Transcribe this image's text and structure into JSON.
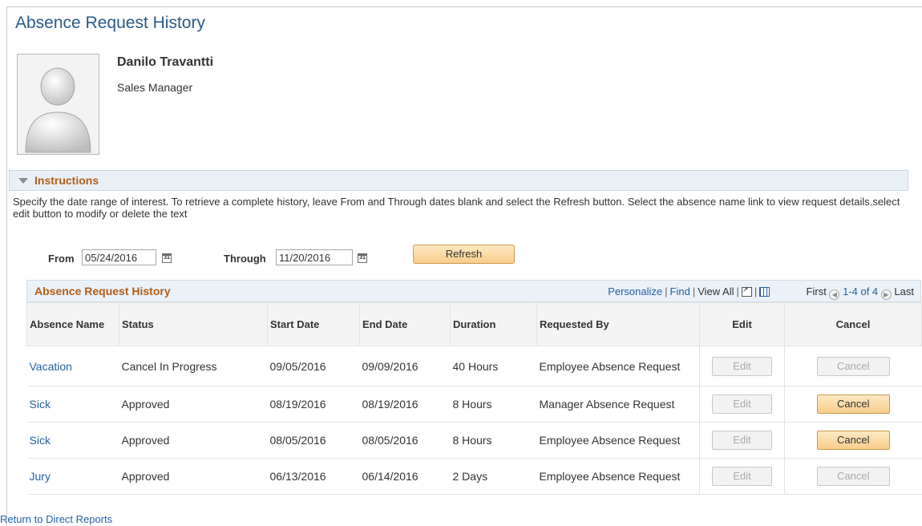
{
  "page": {
    "title": "Absence Request History"
  },
  "employee": {
    "name": "Danilo Travantti",
    "job_title": "Sales Manager"
  },
  "instructions": {
    "label": "Instructions",
    "text": "Specify the date range of interest. To retrieve a complete history, leave From and Through dates blank and select the Refresh button. Select the absence name link to view request details.select edit button to modify or delete the text"
  },
  "filters": {
    "from_label": "From",
    "from_value": "05/24/2016",
    "through_label": "Through",
    "through_value": "11/20/2016",
    "calendar_glyph": "31",
    "refresh_label": "Refresh"
  },
  "grid": {
    "title": "Absence Request History",
    "personalize": "Personalize",
    "find": "Find",
    "view_all": "View All",
    "first": "First",
    "range": "1-4 of 4",
    "last": "Last",
    "columns": [
      "Absence Name",
      "Status",
      "Start Date",
      "End Date",
      "Duration",
      "Requested By",
      "Edit",
      "Cancel"
    ],
    "rows": [
      {
        "name": "Vacation",
        "status": "Cancel In Progress",
        "start": "09/05/2016",
        "end": "09/09/2016",
        "duration": "40 Hours",
        "requested_by": "Employee Absence Request",
        "edit": "Edit",
        "cancel": "Cancel",
        "cancel_enabled": false
      },
      {
        "name": "Sick",
        "status": "Approved",
        "start": "08/19/2016",
        "end": "08/19/2016",
        "duration": "8 Hours",
        "requested_by": "Manager Absence Request",
        "edit": "Edit",
        "cancel": "Cancel",
        "cancel_enabled": true
      },
      {
        "name": "Sick",
        "status": "Approved",
        "start": "08/05/2016",
        "end": "08/05/2016",
        "duration": "8 Hours",
        "requested_by": "Employee Absence Request",
        "edit": "Edit",
        "cancel": "Cancel",
        "cancel_enabled": true
      },
      {
        "name": "Jury",
        "status": "Approved",
        "start": "06/13/2016",
        "end": "06/14/2016",
        "duration": "2 Days",
        "requested_by": "Employee Absence Request",
        "edit": "Edit",
        "cancel": "Cancel",
        "cancel_enabled": false
      }
    ]
  },
  "footer": {
    "return_link": "Return to Direct Reports"
  },
  "colors": {
    "title_blue": "#2a5a8c",
    "link_blue": "#2460a7",
    "section_orange": "#b35d1a",
    "header_bg": "#eaf1f7",
    "button_orange": "#f8cd8a"
  }
}
